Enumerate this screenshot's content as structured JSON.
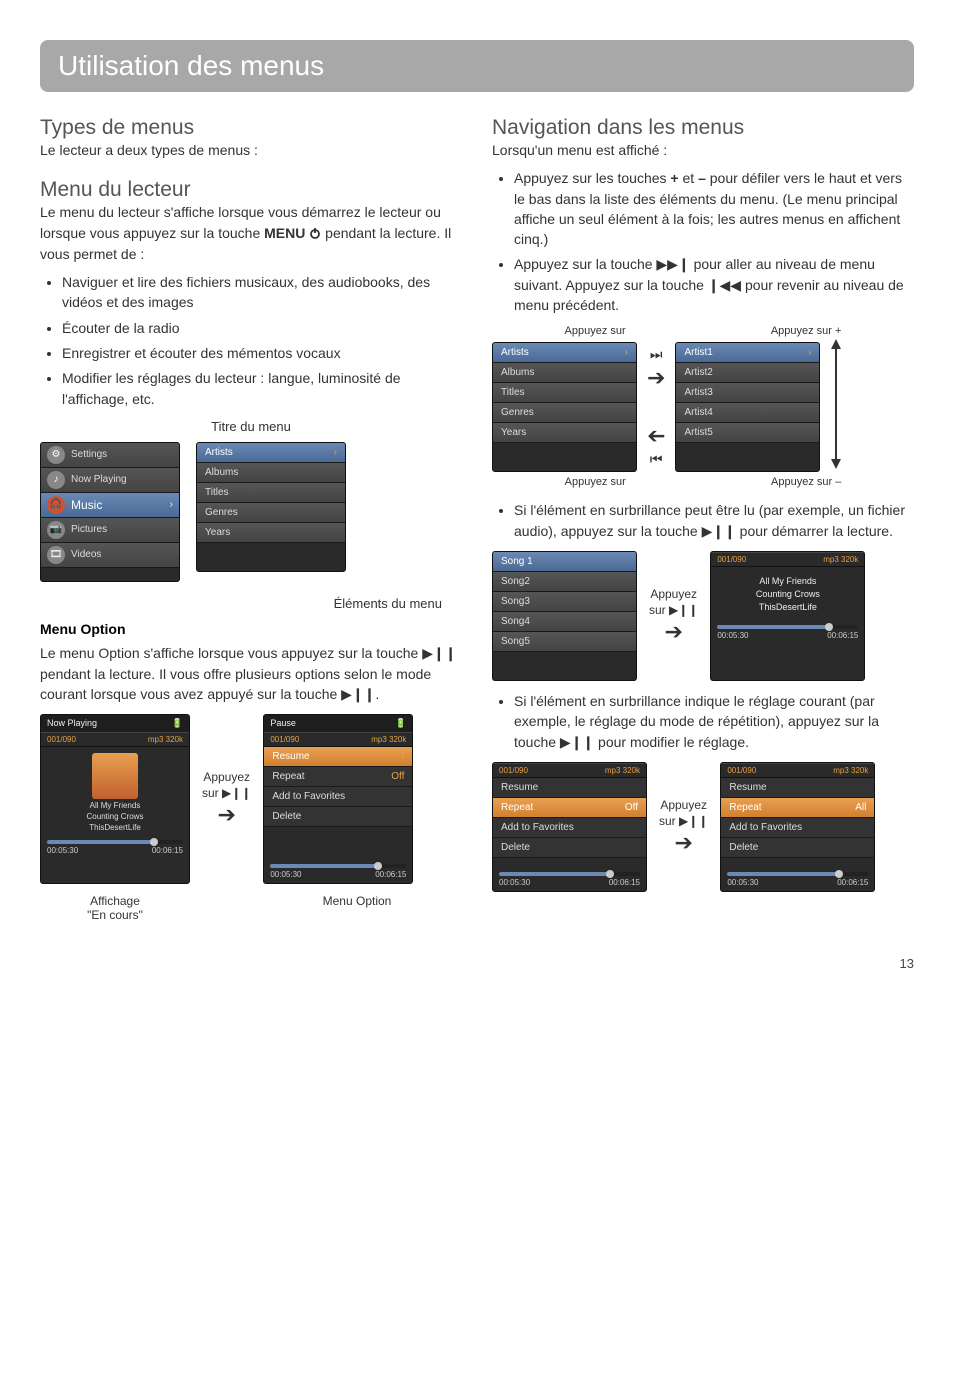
{
  "page_number": "13",
  "title_bar": "Utilisation des menus",
  "left": {
    "h_types": "Types de menus",
    "p_types": "Le lecteur a deux types de menus :",
    "h_player": "Menu du lecteur",
    "p_player": "Le menu du lecteur s'affiche lorsque vous démarrez le lecteur ou lorsque vous appuyez sur la touche ",
    "p_player_bold": "MENU",
    "p_player_tail": " pendant la lecture. Il vous permet de :",
    "player_bullets": [
      "Naviguer et lire des fichiers musicaux, des audiobooks, des vidéos et des images",
      "Écouter de la radio",
      "Enregistrer et écouter des mémentos vocaux",
      "Modifier les réglages du lecteur : langue, luminosité de l'affichage, etc."
    ],
    "label_title": "Titre du menu",
    "label_items": "Éléments du menu",
    "home_menu": [
      "Settings",
      "Now Playing",
      "Music",
      "Pictures",
      "Videos"
    ],
    "artists_menu": [
      "Artists",
      "Albums",
      "Titles",
      "Genres",
      "Years"
    ],
    "h_option_bold": "Menu Option",
    "p_option": "Le menu Option s'affiche lorsque vous appuyez sur la touche ▶❙❙ pendant la lecture. Il vous offre plusieurs options selon le mode courant lorsque vous avez appuyé sur la touche ▶❙❙.",
    "np": {
      "title": "Now Playing",
      "counter": "001/090",
      "codec": "mp3 320k",
      "lines": [
        "All My Friends",
        "Counting Crows",
        "ThisDesertLife"
      ],
      "t_elapsed": "00:05:30",
      "t_total": "00:06:15"
    },
    "press_label_1": "Appuyez",
    "press_label_2": "sur ▶❙❙",
    "pause": {
      "title": "Pause",
      "resume": "Resume",
      "repeat": "Repeat",
      "repeat_val": "Off",
      "addfav": "Add to Favorites",
      "delete": "Delete"
    },
    "cap_now": "Affichage",
    "cap_now2": "\"En cours\"",
    "cap_option": "Menu Option"
  },
  "right": {
    "h_nav": "Navigation dans les menus",
    "p_nav": "Lorsqu'un menu est affiché :",
    "bul1_a": "Appuyez sur les touches ",
    "bul1_plus": "+",
    "bul1_mid": " et ",
    "bul1_minus": "–",
    "bul1_b": " pour défiler vers le haut et vers le bas dans la liste des éléments du menu. (Le menu principal affiche un seul élément à la fois; les autres menus en affichent cinq.)",
    "bul2": "Appuyez sur la touche ▶▶❙ pour aller au niveau de menu suivant. Appuyez sur la touche ❙◀◀ pour revenir au niveau de menu précédent.",
    "lbl_press": "Appuyez sur",
    "lbl_press_plus": "Appuyez sur +",
    "lbl_press_minus": "Appuyez sur –",
    "artist_list": [
      "Artist1",
      "Artist2",
      "Artist3",
      "Artist4",
      "Artist5"
    ],
    "bul3": "Si l'élément en surbrillance peut être lu (par exemple, un fichier audio), appuyez sur la touche ▶❙❙ pour démarrer la lecture.",
    "songs": [
      "Song 1",
      "Song2",
      "Song3",
      "Song4",
      "Song5"
    ],
    "np_inner": {
      "counter": "001/090",
      "codec": "mp3 320k",
      "l1": "All My Friends",
      "l2": "Counting Crows",
      "l3": "ThisDesertLife",
      "t_elapsed": "00:05:30",
      "t_total": "00:06:15"
    },
    "bul4": "Si l'élément en surbrillance indique le réglage courant (par exemple, le réglage du mode de répétition), appuyez sur la touche ▶❙❙ pour modifier le réglage.",
    "opt_off": {
      "resume": "Resume",
      "repeat": "Repeat",
      "repeat_val": "Off",
      "addfav": "Add to Favorites",
      "delete": "Delete"
    },
    "opt_all": {
      "resume": "Resume",
      "repeat": "Repeat",
      "repeat_val": "All",
      "addfav": "Add to Favorites",
      "delete": "Delete"
    }
  }
}
